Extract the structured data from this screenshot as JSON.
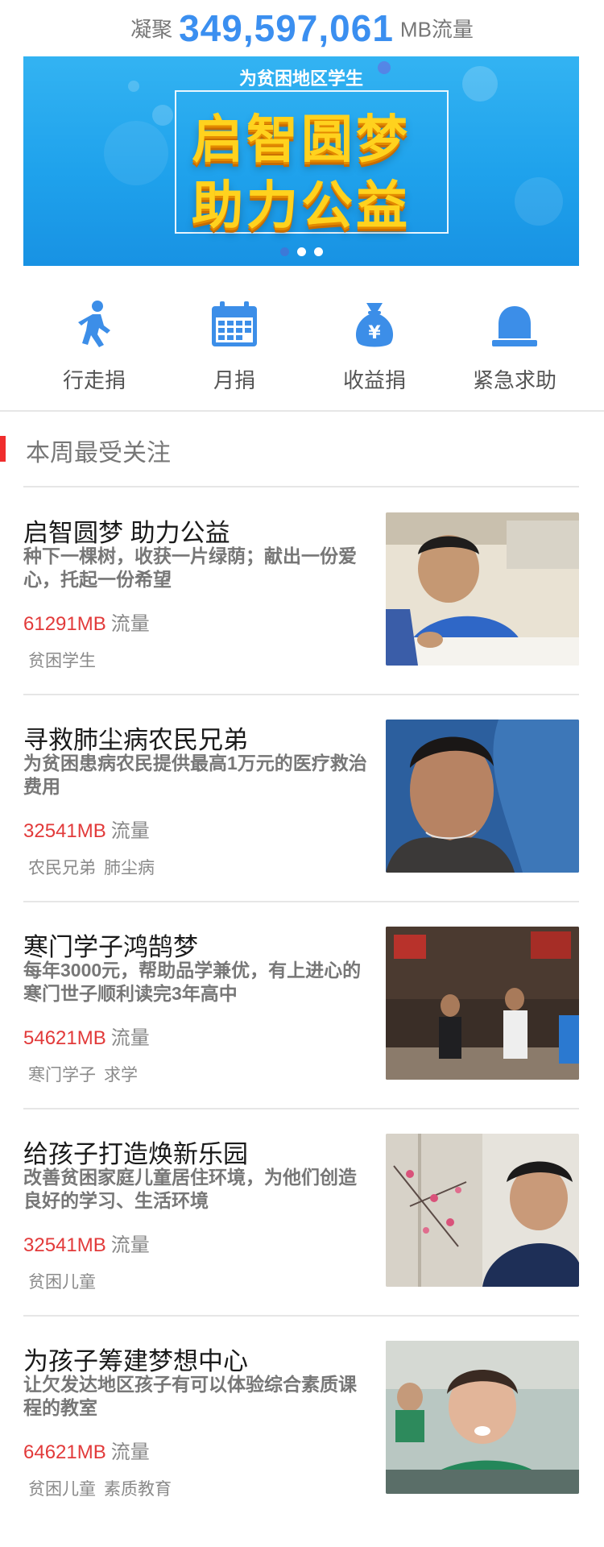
{
  "header": {
    "prefix": "凝聚",
    "number": "349,597,061",
    "suffix": "MB流量"
  },
  "banner": {
    "top_text": "为贫困地区学生",
    "line1": "启智圆梦",
    "line2": "助力公益",
    "dots": 3,
    "active_dot": 0
  },
  "actions": [
    {
      "label": "行走捐",
      "icon": "walking-person-icon"
    },
    {
      "label": "月捐",
      "icon": "calendar-icon"
    },
    {
      "label": "收益捐",
      "icon": "money-bag-icon"
    },
    {
      "label": "紧急求助",
      "icon": "alarm-bell-icon"
    }
  ],
  "section": {
    "title": "本周最受关注"
  },
  "items": [
    {
      "title": "启智圆梦 助力公益",
      "desc": "种下一棵树，收获一片绿荫；献出一份爱心，托起一份希望",
      "flow_value": "61291MB",
      "flow_unit": "流量",
      "tags": [
        "贫困学生"
      ]
    },
    {
      "title": "寻救肺尘病农民兄弟",
      "desc": "为贫困患病农民提供最高1万元的医疗救治费用",
      "flow_value": "32541MB",
      "flow_unit": "流量",
      "tags": [
        "农民兄弟",
        "肺尘病"
      ]
    },
    {
      "title": "寒门学子鸿鹄梦",
      "desc": "每年3000元，帮助品学兼优，有上进心的寒门世子顺利读完3年高中",
      "flow_value": "54621MB",
      "flow_unit": "流量",
      "tags": [
        "寒门学子",
        "求学"
      ]
    },
    {
      "title": "给孩子打造焕新乐园",
      "desc": "改善贫困家庭儿童居住环境，为他们创造良好的学习、生活环境",
      "flow_value": "32541MB",
      "flow_unit": "流量",
      "tags": [
        "贫困儿童"
      ]
    },
    {
      "title": "为孩子筹建梦想中心",
      "desc": "让欠发达地区孩子有可以体验综合素质课程的教室",
      "flow_value": "64621MB",
      "flow_unit": "流量",
      "tags": [
        "贫困儿童",
        "素质教育"
      ]
    }
  ],
  "colors": {
    "accent_blue": "#3b8ff0",
    "flow_red": "#e23a3a",
    "section_bar_red": "#f02d2d",
    "icon_blue": "#3c8ee8"
  }
}
